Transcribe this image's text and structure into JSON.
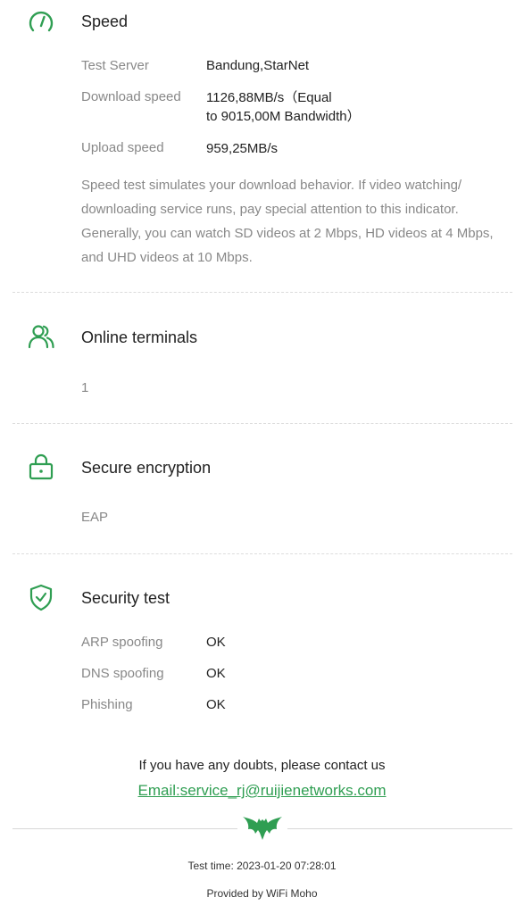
{
  "speed": {
    "title": "Speed",
    "rows": [
      {
        "label": "Test Server",
        "value": "Bandung,StarNet"
      },
      {
        "label": "Download speed",
        "value": "1126,88MB/s（Equal",
        "value2": "to 9015,00M Bandwidth）"
      },
      {
        "label": "Upload speed",
        "value": "959,25MB/s"
      }
    ],
    "description": "Speed test simulates your download behavior. If video watching/ downloading service runs, pay special attention to this indicator. Generally, you can watch SD videos at 2 Mbps, HD videos at 4 Mbps, and UHD videos at 10 Mbps."
  },
  "online_terminals": {
    "title": "Online terminals",
    "value": "1"
  },
  "secure_encryption": {
    "title": "Secure encryption",
    "value": "EAP"
  },
  "security_test": {
    "title": "Security test",
    "rows": [
      {
        "label": "ARP spoofing",
        "value": "OK"
      },
      {
        "label": "DNS spoofing",
        "value": "OK"
      },
      {
        "label": "Phishing",
        "value": "OK"
      }
    ]
  },
  "footer": {
    "contact_note": "If you have any doubts, please contact us",
    "email": "Email:service_rj@ruijienetworks.com",
    "test_time": "Test time: 2023-01-20 07:28:01",
    "provided_by": "Provided by WiFi Moho"
  },
  "colors": {
    "accent": "#2f9e52",
    "label": "#888888",
    "divider": "#dcdcdc"
  },
  "icons": {
    "speed": "speedometer-icon",
    "terminals": "users-icon",
    "encryption": "lock-icon",
    "security": "shield-check-icon",
    "logo": "bat-logo-icon"
  }
}
